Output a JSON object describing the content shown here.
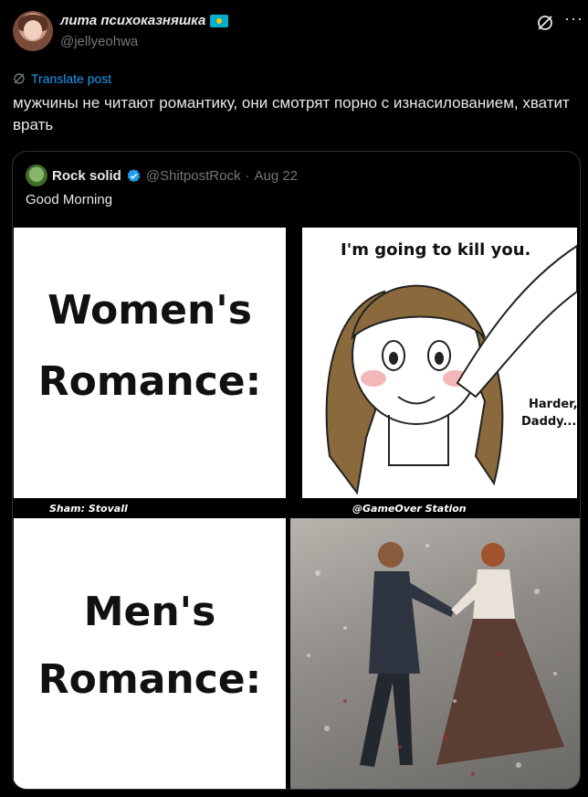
{
  "post": {
    "display_name": "лита психоказняшка",
    "handle": "@jellyeohwa",
    "translate_label": "Translate post",
    "text": "мужчины не читают романтику, они смотрят порно с изнасилованием, хватит врать",
    "more": "···"
  },
  "quote": {
    "name": "Rock solid",
    "handle": "@ShitpostRock",
    "separator": "·",
    "date": "Aug 22",
    "text": "Good Morning",
    "meme": {
      "top_left_label_line1": "Women's",
      "top_left_label_line2": "Romance:",
      "top_left_credit": "Sham: Stovall",
      "top_right_speech": "I'm going to kill you.",
      "top_right_reply_line1": "Harder,",
      "top_right_reply_line2": "Daddy...",
      "top_right_credit": "@GameOver Station",
      "bottom_left_label_line1": "Men's",
      "bottom_left_label_line2": "Romance:"
    }
  },
  "colors": {
    "background": "#000000",
    "text_primary": "#e7e9ea",
    "text_secondary": "#71767b",
    "link": "#1d9bf0",
    "border": "#2f3336",
    "verified": "#1d9bf0",
    "flag_blue": "#00afca",
    "flag_sun": "#fec50c"
  },
  "icons": {
    "grok": "grok-slash-icon",
    "verified": "verified-badge-icon",
    "translate": "translate-icon",
    "flag": "kazakhstan-flag-icon"
  }
}
